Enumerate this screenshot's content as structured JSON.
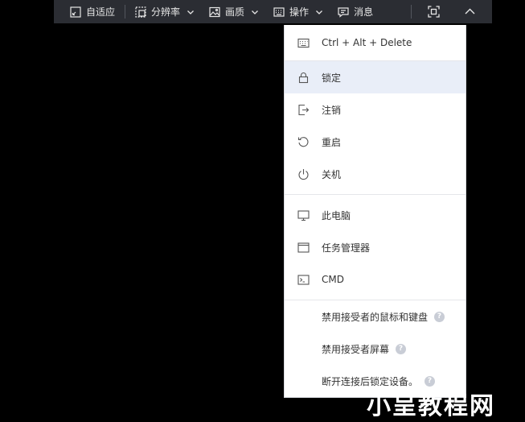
{
  "toolbar": {
    "fit_label": "自适应",
    "resolution_label": "分辨率",
    "quality_label": "画质",
    "operate_label": "操作",
    "message_label": "消息"
  },
  "menu": {
    "items": [
      {
        "label": "Ctrl + Alt + Delete",
        "icon": "keyboard-icon"
      },
      {
        "label": "锁定",
        "icon": "lock-icon"
      },
      {
        "label": "注销",
        "icon": "logout-icon"
      },
      {
        "label": "重启",
        "icon": "restart-icon"
      },
      {
        "label": "关机",
        "icon": "power-icon"
      },
      {
        "label": "此电脑",
        "icon": "monitor-icon"
      },
      {
        "label": "任务管理器",
        "icon": "window-icon"
      },
      {
        "label": "CMD",
        "icon": "terminal-icon"
      }
    ],
    "options": [
      {
        "label": "禁用接受者的鼠标和键盘"
      },
      {
        "label": "禁用接受者屏幕"
      },
      {
        "label": "断开连接后锁定设备。"
      }
    ],
    "help_glyph": "?"
  },
  "watermark": "小呈教程网",
  "colors": {
    "toolbar_bg": "#2b2d33",
    "menu_bg": "#ffffff",
    "active_bg": "#e9eef8"
  }
}
